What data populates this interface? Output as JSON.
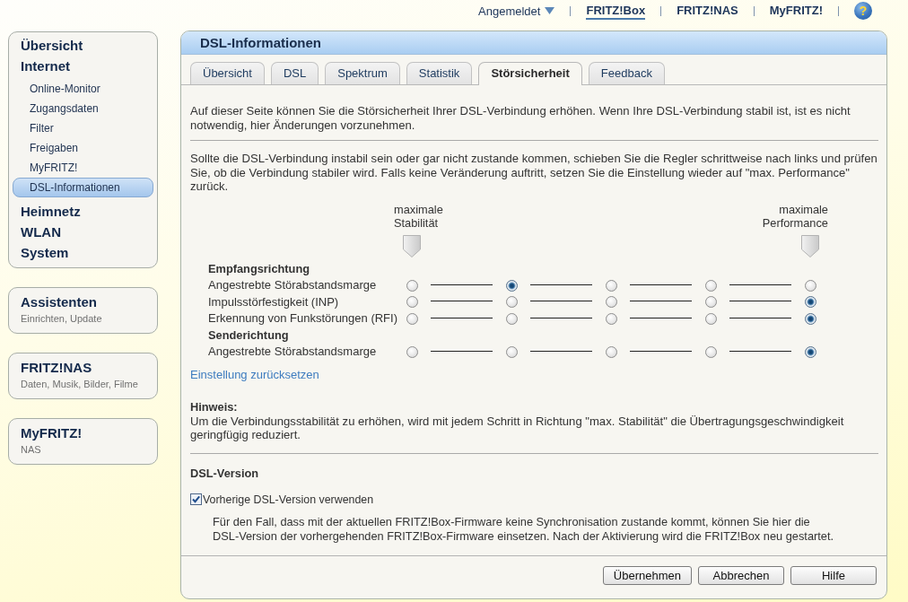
{
  "top_bar": {
    "account": "Angemeldet",
    "links": [
      {
        "label": "FRITZ!Box",
        "selected": true
      },
      {
        "label": "FRITZ!NAS",
        "selected": false
      },
      {
        "label": "MyFRITZ!",
        "selected": false
      }
    ],
    "help": "?"
  },
  "sidebar": {
    "menu": [
      {
        "label": "Übersicht",
        "selected": false
      },
      {
        "label": "Internet",
        "selected": false,
        "children": [
          {
            "label": "Online-Monitor",
            "selected": false
          },
          {
            "label": "Zugangsdaten",
            "selected": false
          },
          {
            "label": "Filter",
            "selected": false
          },
          {
            "label": "Freigaben",
            "selected": false
          },
          {
            "label": "MyFRITZ!",
            "selected": false
          },
          {
            "label": "DSL-Informationen",
            "selected": true
          }
        ]
      },
      {
        "label": "Heimnetz",
        "selected": false
      },
      {
        "label": "WLAN",
        "selected": false
      },
      {
        "label": "System",
        "selected": false
      }
    ],
    "cards": [
      {
        "title": "Assistenten",
        "subtitle": "Einrichten, Update"
      },
      {
        "title": "FRITZ!NAS",
        "subtitle": "Daten, Musik, Bilder, Filme"
      },
      {
        "title": "MyFRITZ!",
        "subtitle": "NAS"
      }
    ]
  },
  "panel": {
    "title": "DSL-Informationen",
    "tabs": [
      {
        "label": "Übersicht",
        "selected": false
      },
      {
        "label": "DSL",
        "selected": false
      },
      {
        "label": "Spektrum",
        "selected": false
      },
      {
        "label": "Statistik",
        "selected": false
      },
      {
        "label": "Störsicherheit",
        "selected": true
      },
      {
        "label": "Feedback",
        "selected": false
      }
    ],
    "intro": "Auf dieser Seite können Sie die Störsicherheit Ihrer DSL-Verbindung erhöhen. Wenn Ihre DSL-Verbindung stabil ist, ist es nicht notwendig, hier Änderungen vorzunehmen.",
    "instructions": "Sollte die DSL-Verbindung instabil sein oder gar nicht zustande kommen, schieben Sie die Regler schrittweise nach links und prüfen Sie, ob die Verbindung stabiler wird. Falls keine Veränderung auftritt, setzen Sie die Einstellung wieder auf \"max. Performance\" zurück.",
    "scale": {
      "left": "maximale Stabilität",
      "right": "maximale Performance"
    },
    "sections": [
      {
        "heading": "Empfangsrichtung",
        "rows": [
          {
            "label": "Angestrebte Störabstandsmarge",
            "options": [
              {
                "selected": false
              },
              {
                "selected": true
              },
              {
                "selected": false
              },
              {
                "selected": false
              },
              {
                "selected": false
              }
            ]
          },
          {
            "label": "Impulsstörfestigkeit (INP)",
            "options": [
              {
                "selected": false
              },
              {
                "selected": false
              },
              {
                "selected": false
              },
              {
                "selected": false
              },
              {
                "selected": true
              }
            ]
          },
          {
            "label": "Erkennung von Funkstörungen (RFI)",
            "options": [
              {
                "selected": false
              },
              {
                "selected": false
              },
              {
                "selected": false
              },
              {
                "selected": false
              },
              {
                "selected": true
              }
            ]
          }
        ]
      },
      {
        "heading": "Senderichtung",
        "rows": [
          {
            "label": "Angestrebte Störabstandsmarge",
            "options": [
              {
                "selected": false
              },
              {
                "selected": false
              },
              {
                "selected": false
              },
              {
                "selected": false
              },
              {
                "selected": true
              }
            ]
          }
        ]
      }
    ],
    "reset_link": "Einstellung zurücksetzen",
    "note": {
      "heading": "Hinweis:",
      "text": "Um die Verbindungsstabilität zu erhöhen, wird mit jedem Schritt in Richtung \"max. Stabilität\" die Übertragungsgeschwindigkeit geringfügig reduziert."
    },
    "dsl_version": {
      "heading": "DSL-Version",
      "checkbox": {
        "label": "Vorherige DSL-Version verwenden",
        "checked": true
      },
      "description": "Für den Fall, dass mit der aktuellen FRITZ!Box-Firmware keine Synchronisation zustande kommt, können Sie hier die DSL-Version der vorhergehenden FRITZ!Box-Firmware einsetzen. Nach der Aktivierung wird die FRITZ!Box neu gestartet."
    },
    "buttons": [
      "Übernehmen",
      "Abbrechen",
      "Hilfe"
    ]
  }
}
